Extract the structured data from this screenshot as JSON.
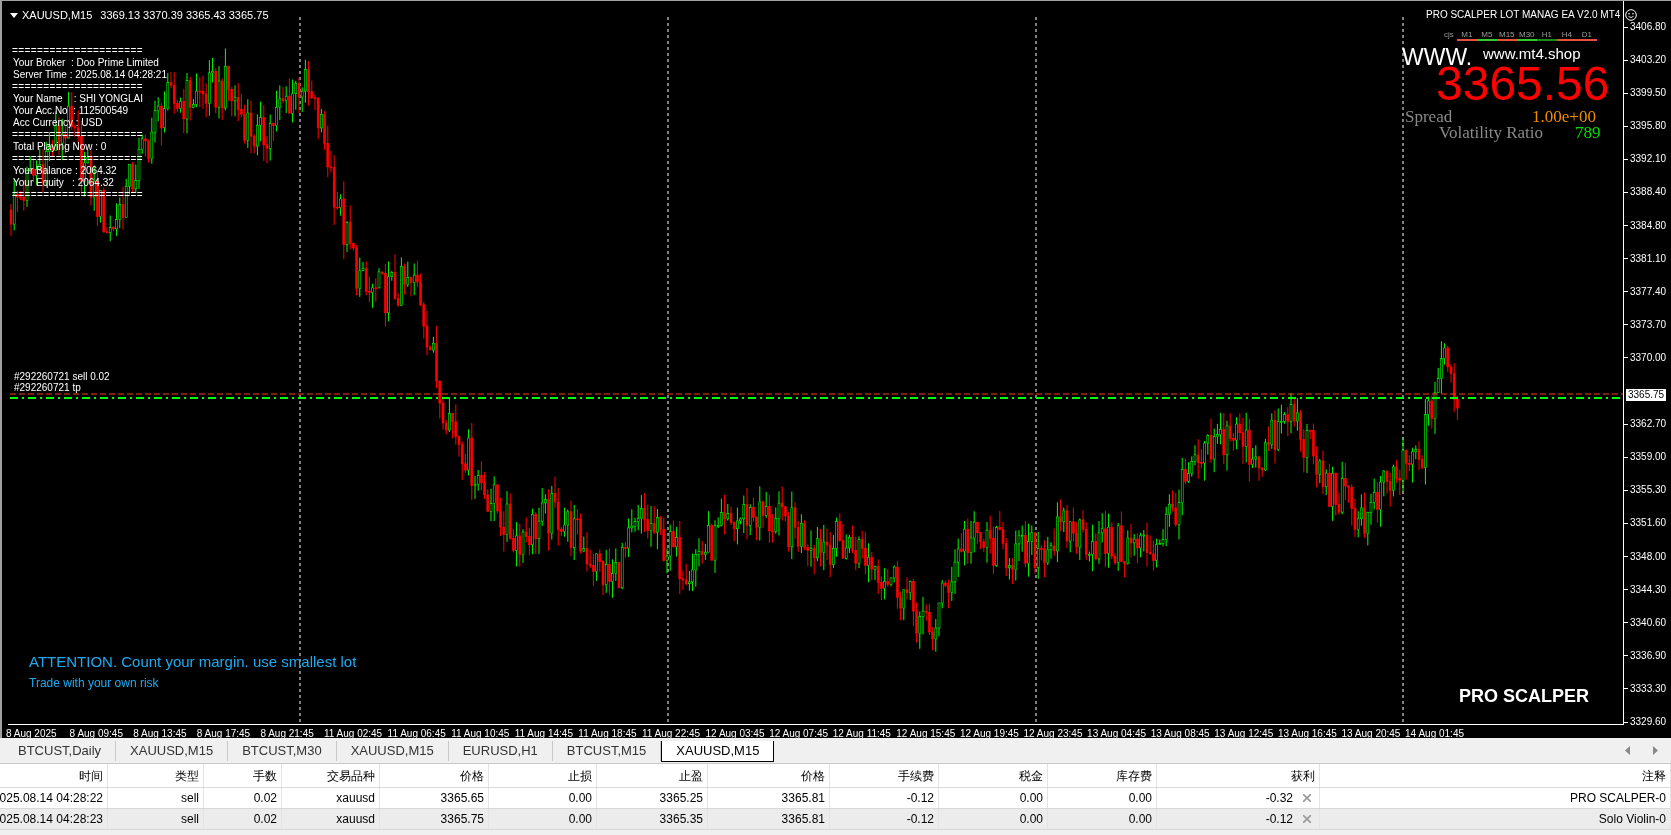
{
  "chart": {
    "symbol": "XAUUSD,M15",
    "ohlc": "3369.13 3370.39 3365.43 3365.75"
  },
  "account_panel": [
    {
      "kind": "rule",
      "text": "====================="
    },
    {
      "kind": "field",
      "text": "Your Broker  : Doo Prime Limited"
    },
    {
      "kind": "field",
      "text": "Server Time : 2025.08.14 04:28:21"
    },
    {
      "kind": "rule",
      "text": "====================="
    },
    {
      "kind": "field",
      "text": "Your Name    : SHI YONGLAI"
    },
    {
      "kind": "field",
      "text": "Your Acc.No  : 112500549"
    },
    {
      "kind": "field",
      "text": "Acc Currency : USD"
    },
    {
      "kind": "rule",
      "text": "====================="
    },
    {
      "kind": "field",
      "text": "Total Playing Now : 0"
    },
    {
      "kind": "rule",
      "text": "====================="
    },
    {
      "kind": "field",
      "text": "Your Balance : 2064.32"
    },
    {
      "kind": "field",
      "text": "Your Equity   : 2064.32"
    },
    {
      "kind": "rule",
      "text": "====================="
    }
  ],
  "ea_panel": {
    "title": "PRO SCALPER LOT MANAG EA  V2.0 MT4",
    "prefix": "cjs",
    "timeframes": [
      {
        "label": "M1",
        "color": "#e8503a"
      },
      {
        "label": "M5",
        "color": "#2ecc2e"
      },
      {
        "label": "M15",
        "color": "#e8503a"
      },
      {
        "label": "M30",
        "color": "#2ecc2e"
      },
      {
        "label": "H1",
        "color": "#1a8a1a"
      },
      {
        "label": "H4",
        "color": "#e8503a"
      },
      {
        "label": "D1",
        "color": "#e8503a"
      }
    ],
    "logo_text": "WWW.",
    "site": "www.mt4.shop",
    "price": "3365.56",
    "spread_label": "Spread",
    "spread_value": "1.00e+00",
    "volatility_label": "Volatility Ratio",
    "volatility_value": "789"
  },
  "order_labels": [
    "#292260721 sell 0.02",
    "#292260721 tp"
  ],
  "current_price": "3365.75",
  "price_axis": [
    "3406.80",
    "3403.20",
    "3399.50",
    "3395.80",
    "3392.10",
    "3388.40",
    "3384.80",
    "3381.10",
    "3377.40",
    "3373.70",
    "3370.00",
    "3362.70",
    "3359.00",
    "3355.30",
    "3351.60",
    "3348.00",
    "3344.30",
    "3340.60",
    "3336.90",
    "3333.30",
    "3329.60"
  ],
  "time_axis": [
    "8 Aug 2025",
    "8 Aug 09:45",
    "8 Aug 13:45",
    "8 Aug 17:45",
    "8 Aug 21:45",
    "11 Aug 02:45",
    "11 Aug 06:45",
    "11 Aug 10:45",
    "11 Aug 14:45",
    "11 Aug 18:45",
    "11 Aug 22:45",
    "12 Aug 03:45",
    "12 Aug 07:45",
    "12 Aug 11:45",
    "12 Aug 15:45",
    "12 Aug 19:45",
    "12 Aug 23:45",
    "13 Aug 04:45",
    "13 Aug 08:45",
    "13 Aug 12:45",
    "13 Aug 16:45",
    "13 Aug 20:45",
    "14 Aug 01:45"
  ],
  "warning": "ATTENTION. Count your margin. use smallest lot",
  "risk_note": "Trade with your own risk",
  "brand": "PRO SCALPER",
  "tabs": [
    {
      "label": "BTCUST,Daily",
      "selected": false
    },
    {
      "label": "XAUUSD,M15",
      "selected": false
    },
    {
      "label": "BTCUST,M30",
      "selected": false
    },
    {
      "label": "XAUUSD,M15",
      "selected": false
    },
    {
      "label": "EURUSD,H1",
      "selected": false
    },
    {
      "label": "BTCUST,M15",
      "selected": false
    },
    {
      "label": "XAUUSD,M15",
      "selected": true
    }
  ],
  "table": {
    "columns": [
      "时间",
      "类型",
      "手数",
      "交易品种",
      "价格",
      "止损",
      "止盈",
      "价格",
      "手续费",
      "税金",
      "库存费",
      "获利",
      "注释"
    ],
    "rows": [
      {
        "selected": false,
        "cells": [
          "025.08.14 04:28:22",
          "sell",
          "0.02",
          "xauusd",
          "3365.65",
          "0.00",
          "3365.25",
          "3365.81",
          "-0.12",
          "0.00",
          "0.00",
          "-0.32",
          "PRO SCALPER-0"
        ]
      },
      {
        "selected": true,
        "cells": [
          "025.08.14 04:28:23",
          "sell",
          "0.02",
          "xauusd",
          "3365.75",
          "0.00",
          "3365.35",
          "3365.81",
          "-0.12",
          "0.00",
          "0.00",
          "-0.12",
          "Solo Violin-0"
        ]
      }
    ]
  }
}
